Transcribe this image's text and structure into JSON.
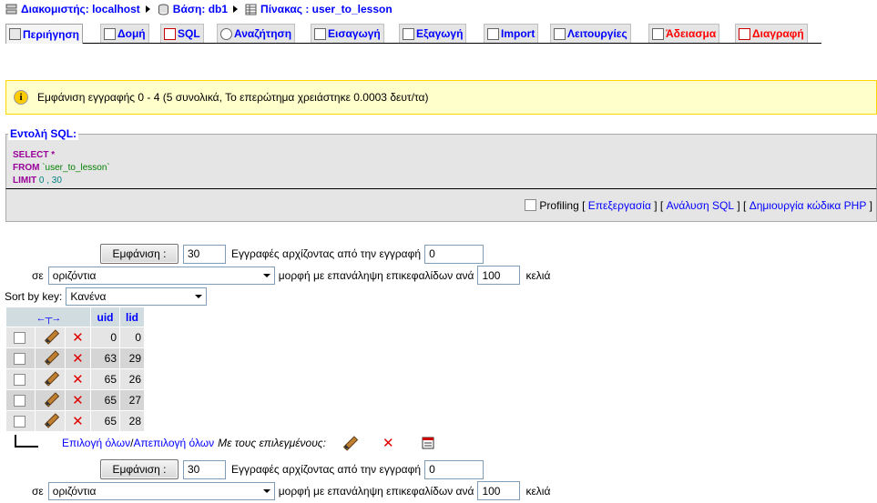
{
  "breadcrumb": {
    "server": "Διακομιστής: localhost",
    "database": "Βάση: db1",
    "table": "Πίνακας : user_to_lesson"
  },
  "tabs": [
    {
      "label": "Περιήγηση",
      "icon": "browse-icon"
    },
    {
      "label": "Δομή",
      "icon": "structure-icon"
    },
    {
      "label": "SQL",
      "icon": "sql-icon"
    },
    {
      "label": "Αναζήτηση",
      "icon": "search-icon"
    },
    {
      "label": "Εισαγωγή",
      "icon": "insert-icon"
    },
    {
      "label": "Εξαγωγή",
      "icon": "export-icon"
    },
    {
      "label": "Import",
      "icon": "import-icon"
    },
    {
      "label": "Λειτουργίες",
      "icon": "operations-icon"
    },
    {
      "label": "Άδειασμα",
      "icon": "empty-icon"
    },
    {
      "label": "Διαγραφή",
      "icon": "drop-icon"
    }
  ],
  "notice": {
    "text": "Εμφάνιση εγγραφής 0 - 4 (5 συνολικά, Το επερώτημα χρειάστηκε 0.0003 δευτ/τα)"
  },
  "sql": {
    "legend": "Εντολή SQL:",
    "select_kw": "SELECT",
    "star": " *",
    "from_kw": "FROM",
    "table": " `user_to_lesson`",
    "limit_kw": "LIMIT",
    "limit_vals": " 0 , 30",
    "profiling_label": "Profiling",
    "edit_link": "Επεξεργασία",
    "explain_link": "Ανάλυση SQL",
    "php_link": "Δημιουργία κώδικα PHP"
  },
  "nav_top": {
    "show_button": "Εμφάνιση :",
    "rows_value": "30",
    "rows_label": "Εγγραφές αρχίζοντας από την εγγραφή",
    "start_value": "0",
    "in_label": "σε",
    "mode_value": "οριζόντια",
    "repeat_label": "μορφή με επανάληψη επικεφαλίδων ανά",
    "repeat_value": "100",
    "cells_label": "κελιά"
  },
  "sort": {
    "label": "Sort by key:",
    "value": "Κανένα"
  },
  "table": {
    "columns": [
      "uid",
      "lid"
    ],
    "rows": [
      {
        "uid": "0",
        "lid": "0"
      },
      {
        "uid": "63",
        "lid": "29"
      },
      {
        "uid": "65",
        "lid": "26"
      },
      {
        "uid": "65",
        "lid": "27"
      },
      {
        "uid": "65",
        "lid": "28"
      }
    ]
  },
  "multi": {
    "check_all": "Επιλογή όλων",
    "separator": " / ",
    "uncheck_all": "Απεπιλογή όλων",
    "with_selected": "Με τους επιλεγμένους:"
  },
  "nav_bottom": {
    "show_button": "Εμφάνιση :",
    "rows_value": "30",
    "rows_label": "Εγγραφές αρχίζοντας από την εγγραφή",
    "start_value": "0",
    "in_label": "σε",
    "mode_value": "οριζόντια",
    "repeat_label": "μορφή με επανάληψη επικεφαλίδων ανά",
    "repeat_value": "100",
    "cells_label": "κελιά"
  }
}
